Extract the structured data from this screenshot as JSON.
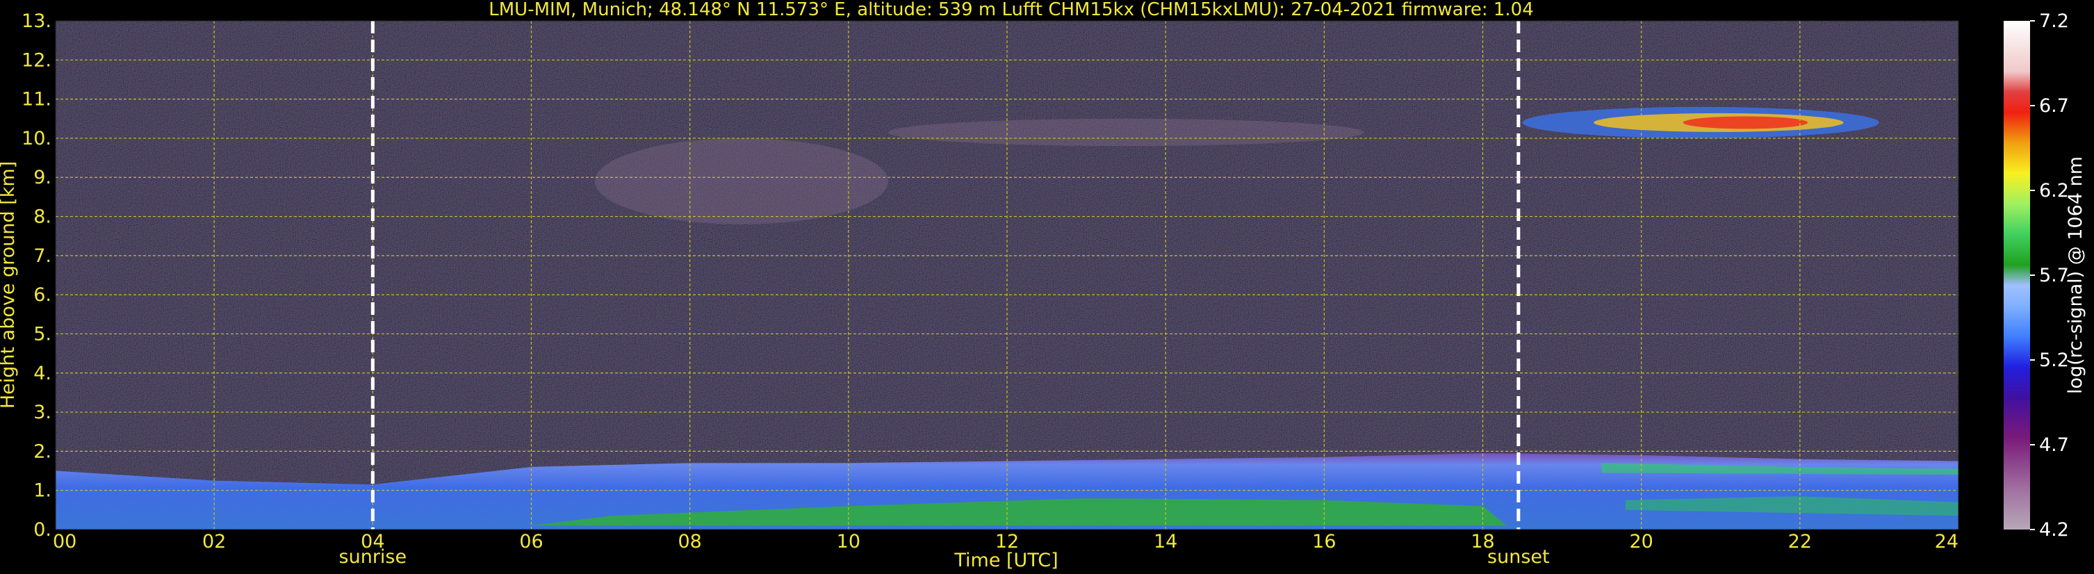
{
  "chart_data": {
    "type": "heatmap",
    "title": "LMU-MIM, Munich; 48.148° N 11.573° E, altitude: 539 m    Lufft CHM15kx (CHM15kxLMU): 27-04-2021    firmware: 1.04",
    "xlabel": "Time [UTC]",
    "ylabel": "Height above ground [km]",
    "xlim": [
      0,
      24
    ],
    "ylim": [
      0,
      13
    ],
    "x_ticks": [
      "00",
      "02",
      "04",
      "06",
      "08",
      "10",
      "12",
      "14",
      "16",
      "18",
      "20",
      "22",
      "24"
    ],
    "y_ticks": [
      "0.",
      "1.",
      "2.",
      "3.",
      "4.",
      "5.",
      "6.",
      "7.",
      "8.",
      "9.",
      "10.",
      "11.",
      "12.",
      "13."
    ],
    "grid": true,
    "sunrise": 4.0,
    "sunset": 18.45,
    "events": [
      {
        "label": "sunrise",
        "x": 4.0
      },
      {
        "label": "sunset",
        "x": 18.45
      }
    ],
    "colorbar": {
      "label": "log(rc-signal) @ 1064 nm",
      "min": 4.2,
      "max": 7.2,
      "ticks": [
        "4.2",
        "4.7",
        "5.2",
        "5.7",
        "6.2",
        "6.7",
        "7.2"
      ]
    },
    "features": {
      "boundary_layer_top_km": [
        [
          0,
          1.5
        ],
        [
          2,
          1.25
        ],
        [
          4,
          1.15
        ],
        [
          6,
          1.6
        ],
        [
          8,
          1.7
        ],
        [
          10,
          1.7
        ],
        [
          12,
          1.75
        ],
        [
          14,
          1.8
        ],
        [
          16,
          1.85
        ],
        [
          18,
          1.95
        ],
        [
          20,
          1.9
        ],
        [
          22,
          1.8
        ],
        [
          24,
          1.75
        ]
      ],
      "cirrus_layer_km": [
        {
          "x": [
            18.5,
            23.0
          ],
          "ybase": 10.0,
          "ytop": 10.8
        },
        {
          "x": [
            6.8,
            10.5
          ],
          "ybase": 7.8,
          "ytop": 10.0
        },
        {
          "x": [
            10.5,
            16.5
          ],
          "ybase": 9.8,
          "ytop": 10.5
        }
      ]
    },
    "colors": {
      "axis_text": "#f2e83a",
      "grid": "#c8c020",
      "background": "#000000"
    }
  }
}
